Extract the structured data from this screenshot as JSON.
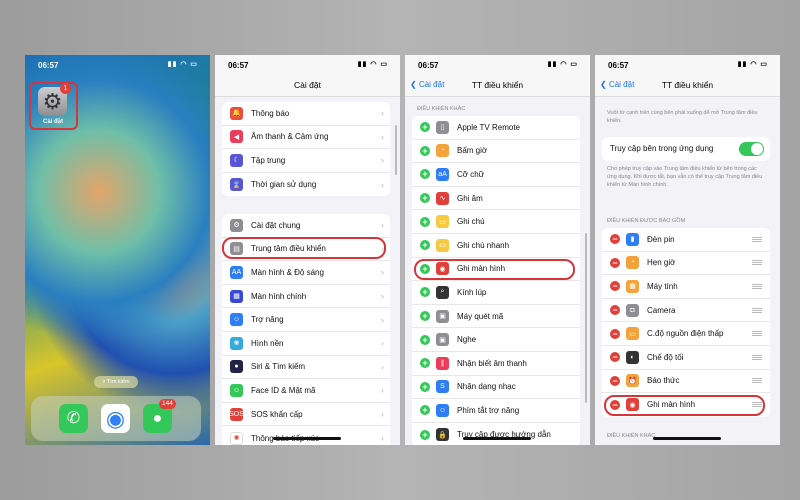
{
  "status": {
    "time": "06:57",
    "icons": "▮▮ ◠ ▭"
  },
  "home": {
    "app_label": "Cài đặt",
    "app_badge": "1",
    "search": "Tìm kiếm",
    "messages_badge": "144"
  },
  "settings": {
    "title": "Cài đặt",
    "group1": [
      {
        "label": "Thông báo",
        "icon": "bell-icon",
        "color": "#ee4b3f",
        "g": "🔔"
      },
      {
        "label": "Âm thanh & Cảm ứng",
        "icon": "speaker-icon",
        "color": "#ea3d5a",
        "g": "◀"
      },
      {
        "label": "Tập trung",
        "icon": "moon-icon",
        "color": "#5a55d6",
        "g": "☾"
      },
      {
        "label": "Thời gian sử dụng",
        "icon": "hourglass-icon",
        "color": "#5a55d6",
        "g": "⌛"
      }
    ],
    "group2": [
      {
        "label": "Cài đặt chung",
        "icon": "gear-icon",
        "color": "#8e8e93",
        "g": "⚙"
      },
      {
        "label": "Trung tâm điều khiển",
        "icon": "control-center-icon",
        "color": "#8e8e93",
        "g": "▤"
      },
      {
        "label": "Màn hình & Độ sáng",
        "icon": "display-icon",
        "color": "#2f7ef6",
        "g": "AA"
      },
      {
        "label": "Màn hình chính",
        "icon": "home-screen-icon",
        "color": "#3a47d8",
        "g": "▦"
      },
      {
        "label": "Trợ năng",
        "icon": "accessibility-icon",
        "color": "#2f7ef6",
        "g": "☺"
      },
      {
        "label": "Hình nền",
        "icon": "wallpaper-icon",
        "color": "#35aadc",
        "g": "❀"
      },
      {
        "label": "Siri & Tìm kiếm",
        "icon": "siri-icon",
        "color": "#222244",
        "g": "●"
      },
      {
        "label": "Face ID & Mật mã",
        "icon": "face-id-icon",
        "color": "#34c759",
        "g": "☺"
      },
      {
        "label": "SOS khẩn cấp",
        "icon": "sos-icon",
        "color": "#e0403a",
        "g": "SOS"
      },
      {
        "label": "Thông báo tiếp xúc",
        "icon": "exposure-icon",
        "color": "#ffffff",
        "g": "✺"
      }
    ]
  },
  "cc_more": {
    "back": "Cài đặt",
    "title": "TT điều khiển",
    "section": "Điều khiển khác",
    "items": [
      {
        "label": "Apple TV Remote",
        "icon": "remote-icon",
        "color": "#8e8e93",
        "g": "▯"
      },
      {
        "label": "Bấm giờ",
        "icon": "stopwatch-icon",
        "color": "#f4a23a",
        "g": "◔"
      },
      {
        "label": "Cỡ chữ",
        "icon": "text-size-icon",
        "color": "#2f7ef6",
        "g": "aA"
      },
      {
        "label": "Ghi âm",
        "icon": "voice-memo-icon",
        "color": "#e0403a",
        "g": "∿"
      },
      {
        "label": "Ghi chú",
        "icon": "notes-icon",
        "color": "#f5c940",
        "g": "▭"
      },
      {
        "label": "Ghi chú nhanh",
        "icon": "quick-note-icon",
        "color": "#f5c940",
        "g": "▭"
      },
      {
        "label": "Ghi màn hình",
        "icon": "screen-record-icon",
        "color": "#e0403a",
        "g": "◉"
      },
      {
        "label": "Kính lúp",
        "icon": "magnifier-icon",
        "color": "#333333",
        "g": "⌕"
      },
      {
        "label": "Máy quét mã",
        "icon": "code-scanner-icon",
        "color": "#8e8e93",
        "g": "▣"
      },
      {
        "label": "Nghe",
        "icon": "hearing-icon",
        "color": "#8e8e93",
        "g": "▣"
      },
      {
        "label": "Nhận biết âm thanh",
        "icon": "sound-recognition-icon",
        "color": "#ea3d5a",
        "g": "∥"
      },
      {
        "label": "Nhận dạng nhạc",
        "icon": "shazam-icon",
        "color": "#2f7ef6",
        "g": "S"
      },
      {
        "label": "Phím tắt trợ năng",
        "icon": "accessibility-shortcut-icon",
        "color": "#2f7ef6",
        "g": "☺"
      },
      {
        "label": "Truy cập được hướng dẫn",
        "icon": "guided-access-icon",
        "color": "#333333",
        "g": "🔒"
      }
    ]
  },
  "cc_included": {
    "back": "Cài đặt",
    "title": "TT điều khiển",
    "desc": "Vuốt từ cạnh trên cùng bên phải xuống để mở Trung tâm điều khiển.",
    "toggle_label": "Truy cập bên trong ứng dụng",
    "toggle_on": true,
    "toggle_note": "Cho phép truy cập vào Trung tâm điều khiển từ bên trong các ứng dụng. Khi được tắt, bạn vẫn có thể truy cập Trung tâm điều khiển từ Màn hình chính.",
    "section": "Điều khiển được bao gồm",
    "section2": "Điều khiển khác",
    "items": [
      {
        "label": "Đèn pin",
        "icon": "flashlight-icon",
        "color": "#2f7ef6",
        "g": "▮"
      },
      {
        "label": "Hẹn giờ",
        "icon": "timer-icon",
        "color": "#f4a23a",
        "g": "◔"
      },
      {
        "label": "Máy tính",
        "icon": "calculator-icon",
        "color": "#f4a23a",
        "g": "▦"
      },
      {
        "label": "Camera",
        "icon": "camera-icon",
        "color": "#8e8e93",
        "g": "◘"
      },
      {
        "label": "C.độ nguồn điện thấp",
        "icon": "low-power-icon",
        "color": "#f4a23a",
        "g": "▭"
      },
      {
        "label": "Chế độ tối",
        "icon": "dark-mode-icon",
        "color": "#333333",
        "g": "◐"
      },
      {
        "label": "Báo thức",
        "icon": "alarm-icon",
        "color": "#f4a23a",
        "g": "⏰"
      },
      {
        "label": "Ghi màn hình",
        "icon": "screen-record-icon",
        "color": "#e0403a",
        "g": "◉"
      }
    ]
  },
  "accent": "#d8343c"
}
